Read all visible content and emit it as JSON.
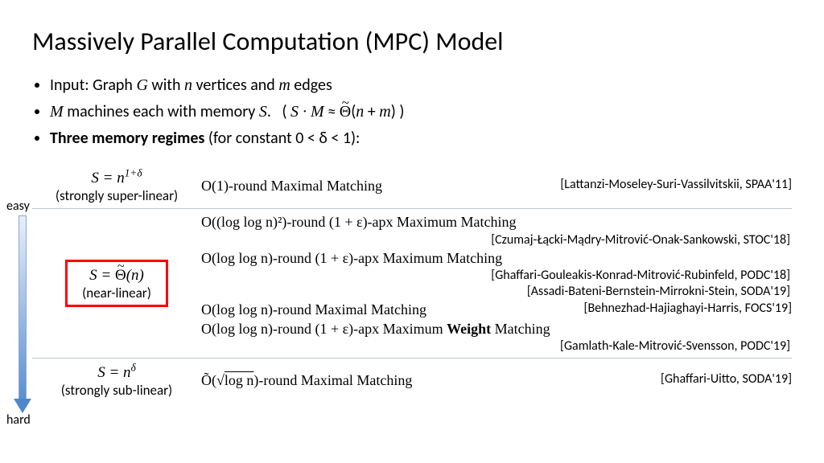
{
  "title": "Massively Parallel Computation (MPC) Model",
  "bullets": {
    "b1_pre": "Input: Graph ",
    "b1_mid": " with ",
    "b1_v": " vertices and ",
    "b1_e": " edges",
    "b2_pre": " machines each with memory ",
    "b2_close": " )",
    "b3_pre": "Three memory regimes",
    "b3_post": " (for constant 0 < δ < 1):"
  },
  "arrow": {
    "top": "easy",
    "bottom": "hard"
  },
  "regimes": {
    "r1": {
      "s": "S = n",
      "exp": "1+δ",
      "sub": "(strongly super-linear)",
      "res": "O(1)-round Maximal Matching",
      "cite": "[Lattanzi-Moseley-Suri-Vassilvitskii, SPAA'11]"
    },
    "r2": {
      "s_pre": "S = ",
      "s_theta": "Θ",
      "s_arg": "(n)",
      "sub": "(near-linear)",
      "l1": "O((log log n)²)-round (1 + ε)-apx Maximum Matching",
      "c1": "[Czumaj-Łącki-Mądry-Mitrović-Onak-Sankowski, STOC'18]",
      "l2": "O(log log n)-round (1 + ε)-apx Maximum Matching",
      "c2a": "[Ghaffari-Gouleakis-Konrad-Mitrović-Rubinfeld, PODC'18]",
      "c2b": "[Assadi-Bateni-Bernstein-Mirrokni-Stein, SODA'19]",
      "l3": "O(log log n)-round Maximal Matching",
      "c3": "[Behnezhad-Hajiaghayi-Harris, FOCS'19]",
      "l4_pre": "O(log log n)-round (1 + ε)-apx Maximum ",
      "l4_b": "Weight",
      "l4_post": " Matching",
      "c4": "[Gamlath-Kale-Mitrović-Svensson, PODC'19]"
    },
    "r3": {
      "s": "S = n",
      "exp": "δ",
      "sub": "(strongly sub-linear)",
      "res_pre": "Õ(√",
      "res_in": "log n",
      "res_post": ")-round Maximal Matching",
      "cite": "[Ghaffari-Uitto, SODA'19]"
    }
  }
}
